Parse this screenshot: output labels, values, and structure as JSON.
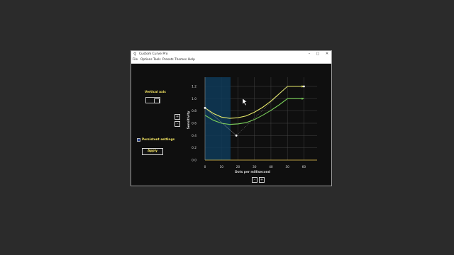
{
  "window": {
    "title": "Custom Curve Pro"
  },
  "menu": [
    "File",
    "Options",
    "Tools",
    "Presets",
    "Themes",
    "Help"
  ],
  "controls": {
    "vertical_axis_label": "Vertical axis",
    "persistent_settings_label": "Persistent settings",
    "apply_label": "Apply"
  },
  "colors": {
    "accent": "#f5e663",
    "curve_primary": "#e5e86a",
    "curve_secondary": "#7bd05a",
    "fill": "#0e3a58",
    "background": "#0f0f0f"
  },
  "chart_data": {
    "type": "line",
    "xlabel": "Dots per millisecond",
    "ylabel": "Sensitivity",
    "x_ticks": [
      "0",
      "10",
      "20",
      "30",
      "40",
      "50",
      "60"
    ],
    "y_ticks": [
      "0.0",
      "0.2",
      "0.4",
      "0.6",
      "0.8",
      "1.0",
      "1.2"
    ],
    "xlim": [
      0,
      68
    ],
    "ylim": [
      0,
      1.35
    ],
    "grid": true,
    "shaded_region_x": [
      0,
      15.5
    ],
    "series": [
      {
        "color": "#e5e86a",
        "x": [
          0,
          5,
          10,
          15,
          20,
          25,
          30,
          35,
          40,
          45,
          50,
          55,
          60
        ],
        "y": [
          0.85,
          0.76,
          0.7,
          0.68,
          0.69,
          0.72,
          0.78,
          0.86,
          0.96,
          1.08,
          1.2,
          1.2,
          1.2
        ]
      },
      {
        "color": "#7bd05a",
        "x": [
          0,
          5,
          10,
          15,
          20,
          25,
          30,
          35,
          40,
          45,
          50,
          55,
          60
        ],
        "y": [
          0.73,
          0.65,
          0.6,
          0.58,
          0.59,
          0.61,
          0.66,
          0.73,
          0.81,
          0.9,
          1.0,
          1.0,
          1.0
        ]
      }
    ],
    "control_points": [
      {
        "x": 0,
        "y": 0.85
      },
      {
        "x": 19,
        "y": 0.4
      },
      {
        "x": 60,
        "y": 1.2
      }
    ]
  }
}
